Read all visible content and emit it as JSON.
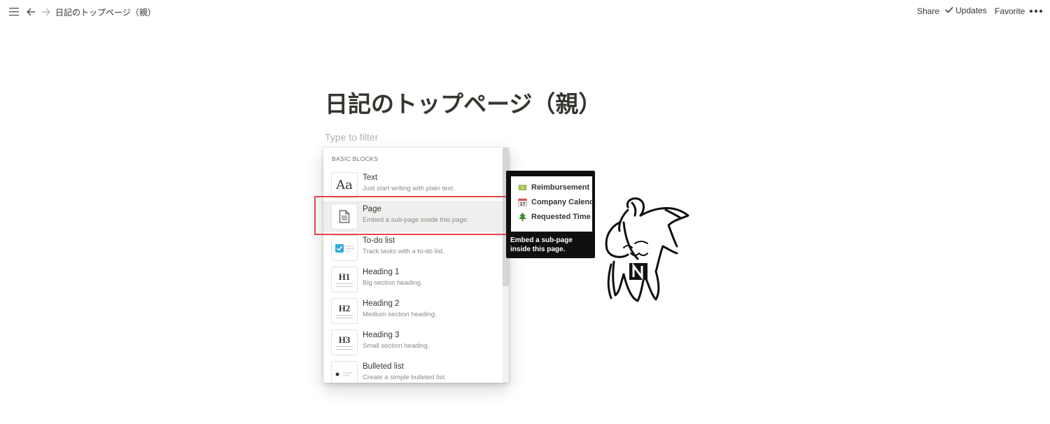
{
  "topbar": {
    "breadcrumb": "日記のトップページ（親）",
    "share": "Share",
    "updates": "Updates",
    "favorite": "Favorite",
    "icons": [
      "menu-icon",
      "arrow-left-icon",
      "arrow-right-icon",
      "check-icon",
      "more-icon"
    ]
  },
  "page": {
    "title": "日記のトップページ（親）",
    "filter_placeholder": "Type to filter"
  },
  "menu": {
    "section": "BASIC BLOCKS",
    "items": [
      {
        "title": "Text",
        "desc": "Just start writing with plain text.",
        "icon": "text-aa-icon"
      },
      {
        "title": "Page",
        "desc": "Embed a sub-page inside this page.",
        "icon": "page-icon"
      },
      {
        "title": "To-do list",
        "desc": "Track tasks with a to-do list.",
        "icon": "todo-checkbox-icon"
      },
      {
        "title": "Heading 1",
        "desc": "Big section heading.",
        "icon": "heading-1-icon"
      },
      {
        "title": "Heading 2",
        "desc": "Medium section heading.",
        "icon": "heading-2-icon"
      },
      {
        "title": "Heading 3",
        "desc": "Small section heading.",
        "icon": "heading-3-icon"
      },
      {
        "title": "Bulleted list",
        "desc": "Create a simple bulleted list.",
        "icon": "bullet-list-icon"
      }
    ],
    "thumb_labels": {
      "text": "Aa",
      "h1": "H1",
      "h2": "H2",
      "h3": "H3"
    }
  },
  "preview": {
    "rows": [
      {
        "label": "Reimbursement",
        "icon": "money-emoji-icon"
      },
      {
        "label": "Company Calendar",
        "icon": "calendar-emoji-icon"
      },
      {
        "label": "Requested Time",
        "icon": "tree-emoji-icon"
      }
    ],
    "caption": "Embed a sub-page inside this page."
  },
  "colors": {
    "highlight_border": "#e3454e",
    "todo_blue": "#2eaadc",
    "tooltip_bg": "#0f0f0f"
  }
}
